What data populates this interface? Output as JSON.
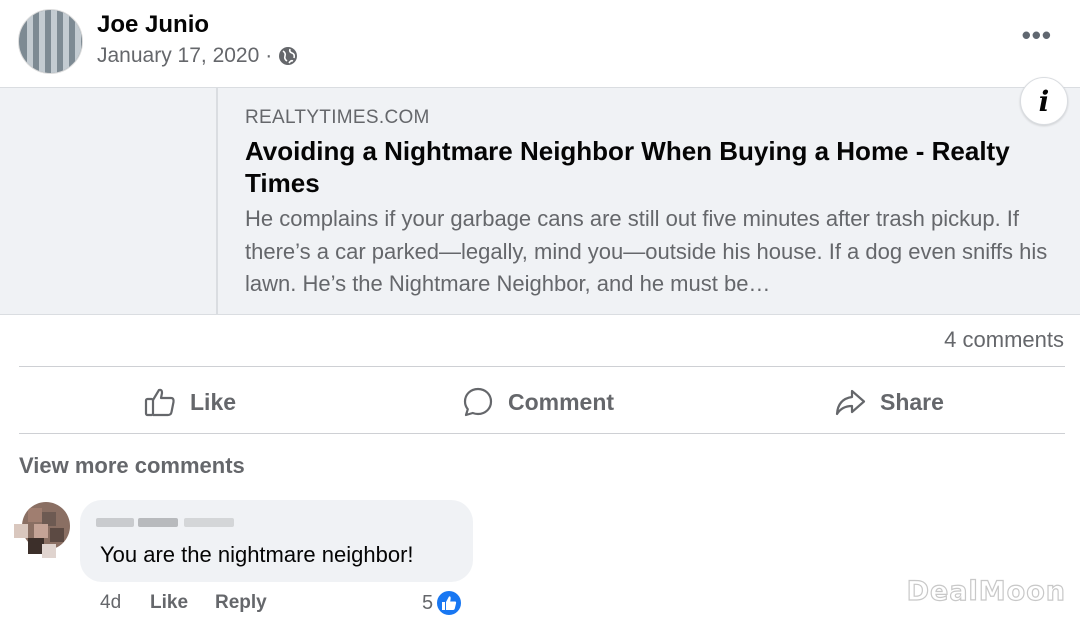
{
  "post": {
    "author": "Joe Junio",
    "date": "January 17, 2020",
    "separator": "·",
    "privacy_icon": "globe-icon",
    "more_icon": "more-horizontal-icon",
    "more_glyph": "•••"
  },
  "link_preview": {
    "domain": "REALTYTIMES.COM",
    "title": "Avoiding a Nightmare Neighbor When Buying a Home - Realty Times",
    "description": "He complains if your garbage cans are still out five minutes after trash pickup. If there’s a car parked—legally, mind you—outside his house. If a dog even sniffs his lawn. He’s the Nightmare Neighbor, and he must be…",
    "info_glyph": "i"
  },
  "stats": {
    "comments_count": "4 comments"
  },
  "actions": {
    "like": "Like",
    "comment": "Comment",
    "share": "Share"
  },
  "comments": {
    "view_more": "View more comments",
    "items": [
      {
        "text": "You are the nightmare neighbor!",
        "age": "4d",
        "like": "Like",
        "reply": "Reply",
        "reaction_count": "5"
      }
    ]
  },
  "watermark": "DealMoon",
  "colors": {
    "primary_text": "#050505",
    "secondary_text": "#65676b",
    "preview_bg": "#f0f2f5",
    "like_blue": "#1877f2"
  }
}
